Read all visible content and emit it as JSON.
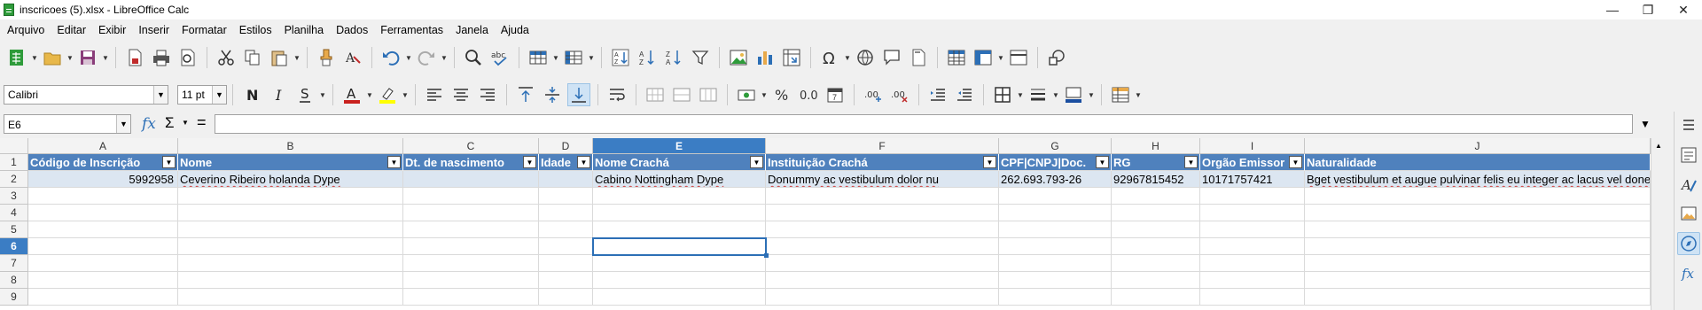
{
  "window": {
    "title": "inscricoes (5).xlsx - LibreOffice Calc",
    "minimize": "—",
    "maximize": "❐",
    "close": "✕"
  },
  "menu": [
    "Arquivo",
    "Editar",
    "Exibir",
    "Inserir",
    "Formatar",
    "Estilos",
    "Planilha",
    "Dados",
    "Ferramentas",
    "Janela",
    "Ajuda"
  ],
  "format_bar": {
    "font_name": "Calibri",
    "font_size": "11 pt"
  },
  "formula_bar": {
    "cell_reference": "E6",
    "formula": ""
  },
  "columns": [
    {
      "letter": "A",
      "selected": false
    },
    {
      "letter": "B",
      "selected": false
    },
    {
      "letter": "C",
      "selected": false
    },
    {
      "letter": "D",
      "selected": false
    },
    {
      "letter": "E",
      "selected": true
    },
    {
      "letter": "F",
      "selected": false
    },
    {
      "letter": "G",
      "selected": false
    },
    {
      "letter": "H",
      "selected": false
    },
    {
      "letter": "I",
      "selected": false
    },
    {
      "letter": "J",
      "selected": false
    }
  ],
  "rows": [
    "1",
    "2",
    "3",
    "4",
    "5",
    "6",
    "7",
    "8",
    "9"
  ],
  "selected_row": "6",
  "table": {
    "headers": [
      "Código de Inscrição",
      "Nome",
      "Dt. de nascimento",
      "Idade",
      "Nome Crachá",
      "Instituição Crachá",
      "CPF|CNPJ|Doc.",
      "RG",
      "Orgão Emissor",
      "Naturalidade"
    ],
    "row2": [
      "5992958",
      "Ceverino Ribeiro holanda Dype",
      "",
      "",
      "Cabino Nottingham Dype",
      "Donummy ac vestibulum dolor nu",
      "262.693.793-26",
      "92967815452",
      "10171757421",
      "Bget vestibulum et augue pulvinar felis eu integer ac lacus vel donec"
    ]
  },
  "colors": {
    "header_fill": "#4f81bd",
    "data_fill": "#dce6f1",
    "selection": "#3b7dc4"
  }
}
